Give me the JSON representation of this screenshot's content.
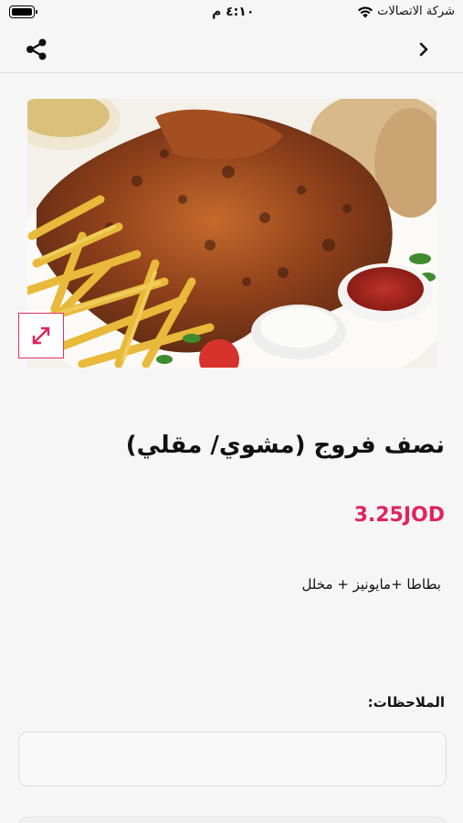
{
  "status_bar": {
    "time": "٤:١٠ م",
    "carrier": "شركة الاتصالات"
  },
  "nav": {
    "share_icon": "share-icon",
    "back_icon": "chevron-right-icon"
  },
  "product": {
    "image_alt": "grilled half chicken with fries, bread and sauces",
    "expand_icon": "expand-icon",
    "title": "نصف فروج (مشوي/ مقلي)",
    "price": "3.25JOD",
    "description": "بطاطا +مايونيز + مخلل"
  },
  "notes": {
    "label": "الملاحظات:",
    "value": "",
    "placeholder": ""
  },
  "colors": {
    "accent": "#e0245e",
    "background": "#f6f6f6"
  }
}
